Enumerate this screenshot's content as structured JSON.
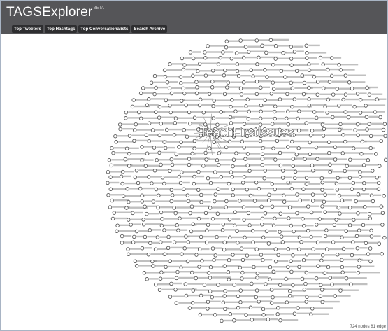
{
  "header": {
    "title": "TAGSExplorer",
    "beta": "BETA"
  },
  "nav": [
    {
      "label": "Top Tweeters"
    },
    {
      "label": "Top Hashtags"
    },
    {
      "label": "Top Conversationalists"
    },
    {
      "label": "Search Archive"
    }
  ],
  "graph": {
    "center_label": "TeachFirstIssues",
    "status": "724 nodes 81 edge",
    "node_color": "#555555",
    "edge_color": "#777777"
  }
}
